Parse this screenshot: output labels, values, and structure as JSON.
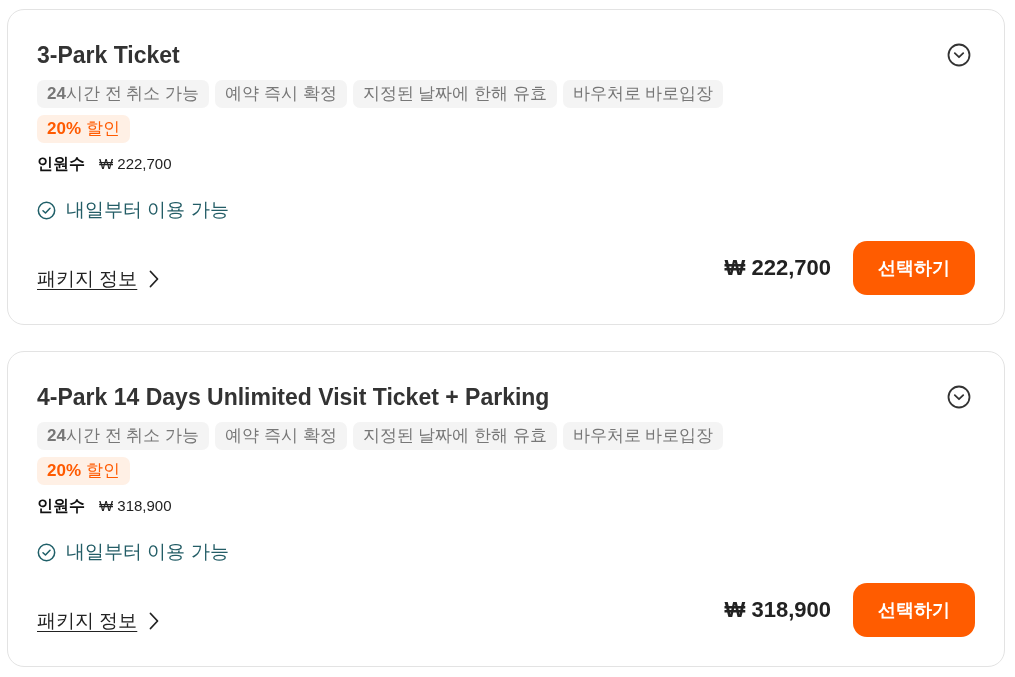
{
  "packages": [
    {
      "title": "3-Park Ticket",
      "expanded": false,
      "tags": [
        "**24**시간 전 취소 가능",
        "예약 즉시 확정",
        "지정된 날짜에 한해 유효",
        "바우처로 바로입장"
      ],
      "discount": "**20%** 할인",
      "headcount_label": "인원수",
      "headcount_price": "₩ 222,700",
      "availability": "내일부터 이용 가능",
      "info_link": "패키지 정보",
      "price": "₩ 222,700",
      "button": "선택하기"
    },
    {
      "title": "4-Park 14 Days Unlimited Visit Ticket + Parking",
      "expanded": false,
      "tags": [
        "**24**시간 전 취소 가능",
        "예약 즉시 확정",
        "지정된 날짜에 한해 유효",
        "바우처로 바로입장"
      ],
      "discount": "**20%** 할인",
      "headcount_label": "인원수",
      "headcount_price": "₩ 318,900",
      "availability": "내일부터 이용 가능",
      "info_link": "패키지 정보",
      "price": "₩ 318,900",
      "button": "선택하기"
    }
  ]
}
